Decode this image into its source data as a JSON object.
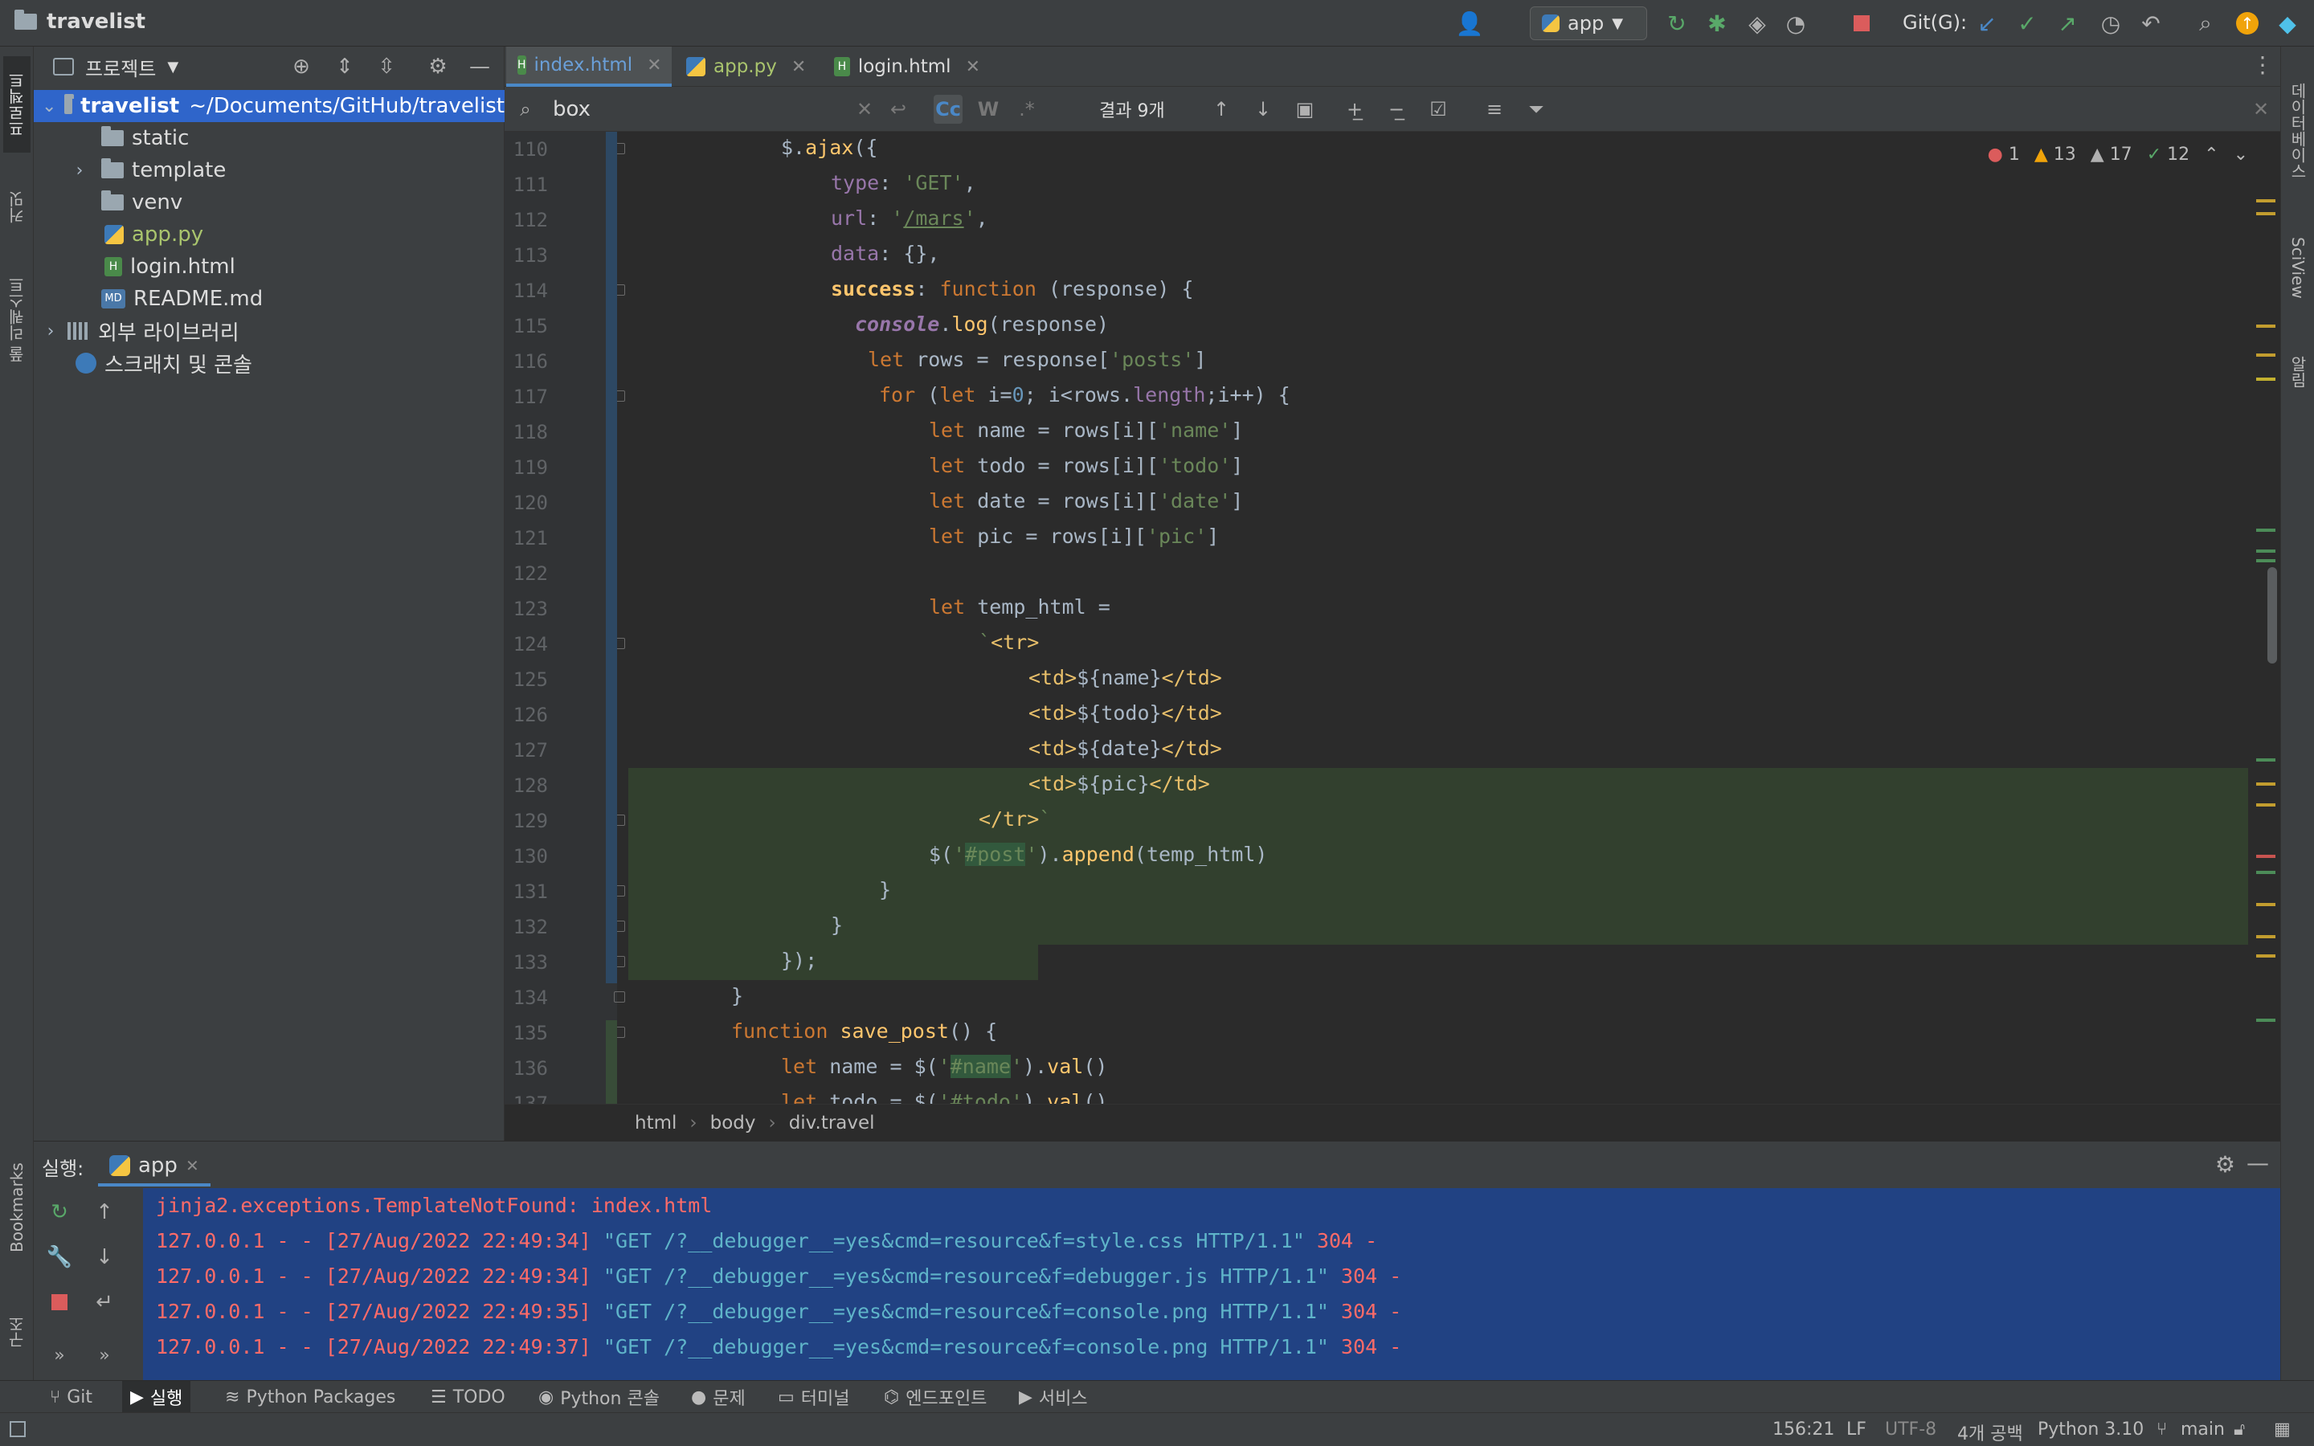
{
  "titlebar": {
    "project_name": "travelist",
    "run_config": "app",
    "git_label": "Git(G):"
  },
  "left_strip": {
    "tabs": [
      "프로젝트",
      "커밋",
      "풀 리퀘스트",
      "Bookmarks",
      "구조"
    ]
  },
  "right_strip": {
    "tabs": [
      "데이터베이스",
      "SciView",
      "알림"
    ]
  },
  "project_panel": {
    "title": "프로젝트",
    "tree": [
      {
        "label": "travelist",
        "path": "~/Documents/GitHub/travelist",
        "type": "folder",
        "selected": true
      },
      {
        "label": "static",
        "type": "folder"
      },
      {
        "label": "template",
        "type": "folder"
      },
      {
        "label": "venv",
        "type": "folder"
      },
      {
        "label": "app.py",
        "type": "py"
      },
      {
        "label": "login.html",
        "type": "html"
      },
      {
        "label": "README.md",
        "type": "md"
      },
      {
        "label": "외부 라이브러리",
        "type": "lib"
      },
      {
        "label": "스크래치 및 콘솔",
        "type": "scratch"
      }
    ]
  },
  "tabs": [
    {
      "label": "index.html",
      "active": true
    },
    {
      "label": "app.py",
      "active": false
    },
    {
      "label": "login.html",
      "active": false
    }
  ],
  "find": {
    "query": "box",
    "case_label": "Cc",
    "word_label": "W",
    "regex_label": ".*",
    "results": "결과 9개"
  },
  "inspections": {
    "errors": "1",
    "warnings": "13",
    "weak_warnings": "17",
    "ok": "12"
  },
  "editor": {
    "line_numbers": [
      "110",
      "111",
      "112",
      "113",
      "114",
      "115",
      "116",
      "117",
      "118",
      "119",
      "120",
      "121",
      "122",
      "123",
      "124",
      "125",
      "126",
      "127",
      "128",
      "129",
      "130",
      "131",
      "132",
      "133",
      "134",
      "135",
      "136",
      "137"
    ]
  },
  "breadcrumbs": [
    "html",
    "body",
    "div.travel"
  ],
  "run_panel": {
    "title": "실행:",
    "tab_label": "app",
    "console": [
      {
        "prefix": "jinja2.exceptions.TemplateNotFound: index.html",
        "request": "",
        "suffix": ""
      },
      {
        "prefix": "127.0.0.1 - - [27/Aug/2022 22:49:34] ",
        "request": "\"GET /?__debugger__=yes&cmd=resource&f=style.css HTTP/1.1\"",
        "suffix": " 304 -"
      },
      {
        "prefix": "127.0.0.1 - - [27/Aug/2022 22:49:34] ",
        "request": "\"GET /?__debugger__=yes&cmd=resource&f=debugger.js HTTP/1.1\"",
        "suffix": " 304 -"
      },
      {
        "prefix": "127.0.0.1 - - [27/Aug/2022 22:49:35] ",
        "request": "\"GET /?__debugger__=yes&cmd=resource&f=console.png HTTP/1.1\"",
        "suffix": " 304 -"
      },
      {
        "prefix": "127.0.0.1 - - [27/Aug/2022 22:49:37] ",
        "request": "\"GET /?__debugger__=yes&cmd=resource&f=console.png HTTP/1.1\"",
        "suffix": " 304 -"
      }
    ]
  },
  "toolstrip": [
    {
      "label": "Git",
      "icon": "git-branch-icon"
    },
    {
      "label": "실행",
      "icon": "play-icon",
      "active": true
    },
    {
      "label": "Python Packages",
      "icon": "layers-icon"
    },
    {
      "label": "TODO",
      "icon": "list-icon"
    },
    {
      "label": "Python 콘솔",
      "icon": "python-icon"
    },
    {
      "label": "문제",
      "icon": "info-icon"
    },
    {
      "label": "터미널",
      "icon": "terminal-icon"
    },
    {
      "label": "엔드포인트",
      "icon": "endpoints-icon"
    },
    {
      "label": "서비스",
      "icon": "services-icon"
    }
  ],
  "statusbar": {
    "position": "156:21",
    "line_sep": "LF",
    "encoding": "UTF-8",
    "indent": "4개 공백",
    "interpreter": "Python 3.10",
    "branch": "main"
  },
  "colors": {
    "accent": "#4a88c7",
    "selection": "#2f65ca",
    "console_bg": "#214283",
    "error": "#ff6b68"
  }
}
